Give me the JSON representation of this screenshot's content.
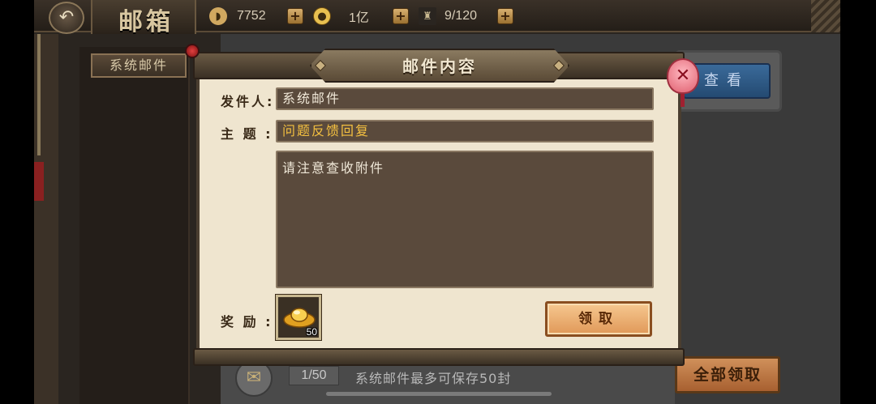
{
  "header": {
    "title": "邮箱",
    "resources": [
      {
        "icon": "ingot-icon",
        "value": "7752"
      },
      {
        "icon": "coin-icon",
        "value": "1亿"
      },
      {
        "icon": "stamina-icon",
        "value": "9/120"
      }
    ]
  },
  "sidebar": {
    "tab_label": "系统邮件"
  },
  "background": {
    "view_button": "查看",
    "mail_count": "1/50",
    "limit_text": "系统邮件最多可保存50封",
    "collect_all_button": "全部领取"
  },
  "dialog": {
    "title": "邮件内容",
    "sender_label": "发件人:",
    "sender_value": "系统邮件",
    "subject_label": "主 题 :",
    "subject_value": "问题反馈回复",
    "body": "请注意查收附件",
    "reward_label": "奖 励 :",
    "reward_item": {
      "icon": "gold-ingot-icon",
      "count": "50"
    },
    "claim_button": "领取"
  },
  "colors": {
    "subject_text": "#f4c040",
    "dialog_bg": "#efe5cf",
    "claim_button": "#f0b070"
  }
}
